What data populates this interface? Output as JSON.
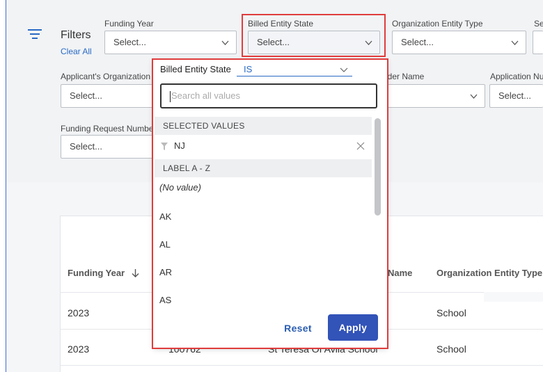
{
  "filters": {
    "title": "Filters",
    "clear_all": "Clear All",
    "funding_year": {
      "label": "Funding Year",
      "value": "Select..."
    },
    "billed_entity_state": {
      "label": "Billed Entity State",
      "value": "Select..."
    },
    "organization_entity_type": {
      "label": "Organization Entity Type",
      "value": "Select..."
    },
    "fourth_label": "Se",
    "applicants_org": {
      "label": "Applicant's Organization",
      "value": "Select..."
    },
    "provider_name": {
      "label": "vider Name"
    },
    "application_number": {
      "label": "Application Nu",
      "value": "Select..."
    },
    "funding_request_number": {
      "label": "Funding Request Numbe",
      "value": "Select..."
    }
  },
  "table": {
    "headers": {
      "funding_year": "Funding Year",
      "name": "Name",
      "organization_entity_type": "Organization Entity Type"
    },
    "rows": [
      {
        "year": "2023",
        "type": "School"
      },
      {
        "year": "2023",
        "id": "100762",
        "name": "St Teresa Of Avila School",
        "type": "School"
      }
    ]
  },
  "dropdown": {
    "title": "Billed Entity State",
    "operator": "IS",
    "search_placeholder": "Search all values",
    "selected_header": "SELECTED VALUES",
    "selected": [
      "NJ"
    ],
    "label_header": "LABEL A - Z",
    "items": [
      "(No value)",
      "AK",
      "AL",
      "AR",
      "AS"
    ],
    "reset_label": "Reset",
    "apply_label": "Apply"
  },
  "colors": {
    "accent": "#2a6ac4",
    "apply": "#3253b8",
    "highlight": "#e03c3c"
  },
  "icons": [
    "filter-lines-icon",
    "chevron-down-icon",
    "sort-down-arrow-icon",
    "funnel-icon",
    "close-icon"
  ]
}
